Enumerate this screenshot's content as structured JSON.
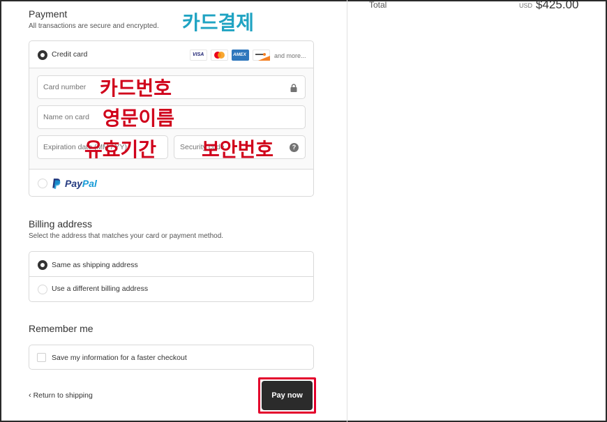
{
  "summary": {
    "total_label": "Total",
    "currency": "USD",
    "total_amount": "$425.00"
  },
  "payment": {
    "title": "Payment",
    "subtitle": "All transactions are secure and encrypted.",
    "credit_card_label": "Credit card",
    "card_brands": [
      "VISA",
      "mastercard",
      "AMEX",
      "discover"
    ],
    "and_more": "and more...",
    "fields": {
      "card_number": "Card number",
      "name_on_card": "Name on card",
      "expiration": "Expiration date (MM / YY)",
      "security_code": "Security code"
    },
    "paypal": {
      "pay": "Pay",
      "pal": "Pal"
    }
  },
  "billing": {
    "title": "Billing address",
    "subtitle": "Select the address that matches your card or payment method.",
    "same_label": "Same as shipping address",
    "different_label": "Use a different billing address"
  },
  "remember": {
    "title": "Remember me",
    "save_label": "Save my information for a faster checkout"
  },
  "footer": {
    "return_label": "Return to shipping",
    "pay_label": "Pay now"
  },
  "annotations": {
    "card_payment": "카드결제",
    "card_number": "카드번호",
    "english_name": "영문이름",
    "expiry": "유효기간",
    "security": "보안번호"
  },
  "colors": {
    "annotation_blue": "#1fa3c2",
    "annotation_red": "#d0021b",
    "pay_button": "#2b2b2b",
    "highlight_box": "#e3002b"
  }
}
